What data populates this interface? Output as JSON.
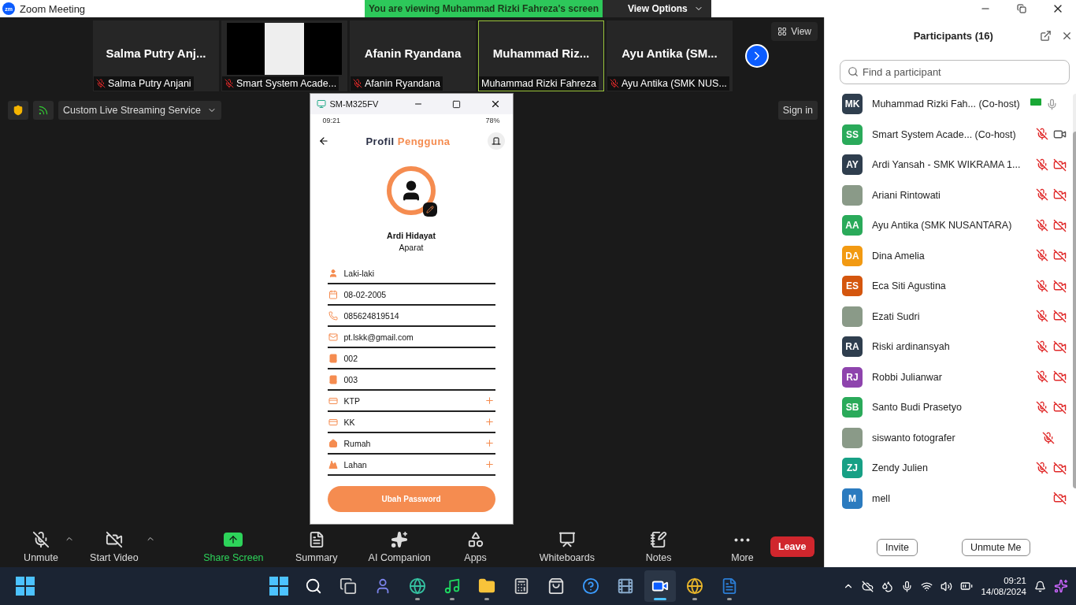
{
  "window": {
    "title": "Zoom Meeting",
    "logo": "zm"
  },
  "banner": {
    "text": "You are viewing Muhammad Rizki Fahreza's screen",
    "button": "View Options"
  },
  "thumbnails": [
    {
      "kind": "name",
      "title": "Salma  Putry  Anj...",
      "label": "Salma Putry Anjani",
      "muted": true,
      "highlighted": false
    },
    {
      "kind": "screen",
      "label": "Smart System Acade...",
      "muted": true,
      "highlighted": false
    },
    {
      "kind": "name",
      "title": "Afanin Ryandana",
      "label": "Afanin Ryandana",
      "muted": true,
      "highlighted": false
    },
    {
      "kind": "name",
      "title": "Muhammad  Riz...",
      "label": "Muhammad Rizki Fahreza",
      "muted": false,
      "highlighted": true
    },
    {
      "kind": "name",
      "title": "Ayu Antika (SM...",
      "label": "Ayu Antika (SMK NUS...",
      "muted": true,
      "highlighted": false
    }
  ],
  "view_button": "View",
  "streaming": {
    "label": "Custom Live Streaming Service"
  },
  "sign_in": "Sign in",
  "phone": {
    "window_title": "SM-M325FV",
    "time": "09:21",
    "battery": "78%",
    "header": "Profil **Pengguna**",
    "name": "Ardi Hidayat",
    "role": "Aparat",
    "fields": [
      {
        "kind": "person",
        "value": "Laki-laki",
        "addable": false
      },
      {
        "kind": "calendar",
        "value": "08-02-2005",
        "addable": false
      },
      {
        "kind": "phone",
        "value": "085624819514",
        "addable": false
      },
      {
        "kind": "mail",
        "value": "pt.lskk@gmail.com",
        "addable": false
      },
      {
        "kind": "book",
        "value": "002",
        "addable": false
      },
      {
        "kind": "book",
        "value": "003",
        "addable": false
      },
      {
        "kind": "card",
        "value": "KTP",
        "addable": true
      },
      {
        "kind": "card",
        "value": "KK",
        "addable": true
      },
      {
        "kind": "home",
        "value": "Rumah",
        "addable": true
      },
      {
        "kind": "land",
        "value": "Lahan",
        "addable": true
      }
    ],
    "button": "Ubah Password"
  },
  "toolbar": {
    "items": [
      {
        "kind": "mic",
        "label": "Unmute",
        "off": true,
        "caret": true
      },
      {
        "kind": "video",
        "label": "Start Video",
        "off": true,
        "caret": true
      },
      {
        "kind": "share",
        "label": "Share Screen",
        "caret": false
      },
      {
        "kind": "summary",
        "label": "Summary",
        "caret": false
      },
      {
        "kind": "ai",
        "label": "AI Companion",
        "caret": false
      },
      {
        "kind": "apps",
        "label": "Apps",
        "caret": false
      },
      {
        "kind": "whiteboard",
        "label": "Whiteboards",
        "caret": false
      },
      {
        "kind": "notes",
        "label": "Notes",
        "caret": false
      },
      {
        "kind": "more",
        "label": "More",
        "caret": false
      }
    ],
    "leave": "Leave"
  },
  "participants": {
    "title": "Participants (16)",
    "search_placeholder": "Find a participant",
    "rows": [
      {
        "name": "Muhammad Rizki Fah...",
        "role": "(Co-host)",
        "photo": false,
        "initials": "MK",
        "color": "#2f3e4e",
        "audio": true,
        "muted": false,
        "video": false,
        "sharing": true
      },
      {
        "name": "Smart System Acade...",
        "role": "(Co-host)",
        "photo": false,
        "initials": "SS",
        "color": "#2aaa5a",
        "audio": true,
        "muted": true,
        "video": true,
        "video_off": false,
        "sharing": false
      },
      {
        "name": "Ardi Yansah - SMK WIKRAMA 1...",
        "photo": false,
        "initials": "AY",
        "color": "#2f3e4e",
        "audio": true,
        "muted": true,
        "video": true,
        "video_off": true,
        "sharing": false
      },
      {
        "name": "Ariani Rintowati",
        "photo": true,
        "audio": true,
        "muted": true,
        "video": true,
        "video_off": true,
        "sharing": false
      },
      {
        "name": "Ayu Antika (SMK NUSANTARA)",
        "photo": false,
        "initials": "AA",
        "color": "#2aaa5a",
        "audio": true,
        "muted": true,
        "video": true,
        "video_off": true,
        "sharing": false
      },
      {
        "name": "Dina Amelia",
        "photo": false,
        "initials": "DA",
        "color": "#f29a12",
        "audio": true,
        "muted": true,
        "video": true,
        "video_off": true,
        "sharing": false
      },
      {
        "name": "Eca Siti Agustina",
        "photo": false,
        "initials": "ES",
        "color": "#d4560e",
        "audio": true,
        "muted": true,
        "video": true,
        "video_off": true,
        "sharing": false
      },
      {
        "name": "Ezati Sudri",
        "photo": true,
        "audio": true,
        "muted": true,
        "video": true,
        "video_off": true,
        "sharing": false
      },
      {
        "name": "Riski ardinansyah",
        "photo": false,
        "initials": "RA",
        "color": "#2f3e4e",
        "audio": true,
        "muted": true,
        "video": true,
        "video_off": true,
        "sharing": false
      },
      {
        "name": "Robbi Julianwar",
        "photo": false,
        "initials": "RJ",
        "color": "#8e44ad",
        "audio": true,
        "muted": true,
        "video": true,
        "video_off": true,
        "sharing": false
      },
      {
        "name": "Santo Budi Prasetyo",
        "photo": false,
        "initials": "SB",
        "color": "#2aaa5a",
        "audio": true,
        "muted": true,
        "video": true,
        "video_off": true,
        "sharing": false
      },
      {
        "name": "siswanto fotografer",
        "photo": true,
        "audio": true,
        "muted": true,
        "video": false,
        "sharing": false
      },
      {
        "name": "Zendy Julien",
        "photo": false,
        "initials": "ZJ",
        "color": "#17a085",
        "audio": true,
        "muted": true,
        "video": true,
        "video_off": true,
        "sharing": false
      },
      {
        "name": "mell",
        "photo": false,
        "initials": "M",
        "color": "#2b7bbf",
        "audio": false,
        "video": true,
        "video_off": true,
        "sharing": false
      }
    ],
    "buttons": [
      "Invite",
      "Unmute Me"
    ]
  },
  "taskbar": {
    "apps": [
      {
        "kind": "start",
        "running": false,
        "active": false
      },
      {
        "kind": "search",
        "running": false,
        "active": false
      },
      {
        "kind": "taskview",
        "running": false,
        "active": false
      },
      {
        "kind": "teams",
        "running": false,
        "active": false
      },
      {
        "kind": "edge",
        "running": true,
        "active": false
      },
      {
        "kind": "spotify",
        "running": true,
        "active": false
      },
      {
        "kind": "explorer",
        "running": true,
        "active": false
      },
      {
        "kind": "calculator",
        "running": false,
        "active": false
      },
      {
        "kind": "store",
        "running": false,
        "active": false
      },
      {
        "kind": "help",
        "running": false,
        "active": false
      },
      {
        "kind": "media",
        "running": false,
        "active": false
      },
      {
        "kind": "zoom",
        "running": true,
        "active": true
      },
      {
        "kind": "chrome",
        "running": true,
        "active": false
      },
      {
        "kind": "word",
        "running": true,
        "active": false
      }
    ],
    "time": "09:21",
    "date": "14/08/2024"
  }
}
